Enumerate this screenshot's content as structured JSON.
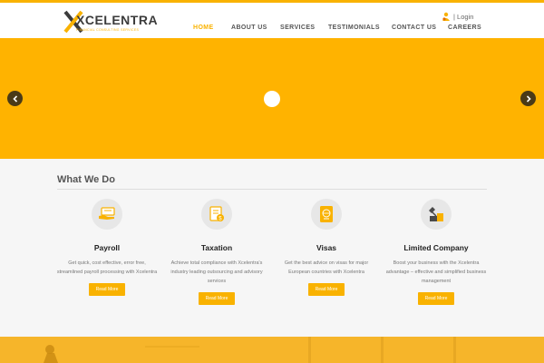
{
  "brand": {
    "name": "XCELENTRA",
    "tagline": "FINANCIAL CONSULTING SERVICES",
    "accent": "#f9b200"
  },
  "header": {
    "login_label": "| Login",
    "login_icon": "user-icon"
  },
  "nav": {
    "items": [
      {
        "label": "HOME",
        "active": true
      },
      {
        "label": "ABOUT US",
        "active": false
      },
      {
        "label": "SERVICES",
        "active": false
      },
      {
        "label": "TESTIMONIALS",
        "active": false
      },
      {
        "label": "CONTACT US",
        "active": false
      },
      {
        "label": "CAREERS",
        "active": false
      }
    ]
  },
  "slider": {
    "background": "#ffb300",
    "prev_icon": "chevron-left-icon",
    "next_icon": "chevron-right-icon"
  },
  "what_we_do": {
    "title": "What We Do",
    "cards": [
      {
        "icon": "payroll-icon",
        "title": "Payroll",
        "text": "Get quick, cost effective, error free, streamlined payroll processing with Xcelentra",
        "button": "Read More"
      },
      {
        "icon": "taxation-icon",
        "title": "Taxation",
        "text": "Achieve total compliance with Xcelentra's industry leading outsourcing and advisory services",
        "button": "Read More"
      },
      {
        "icon": "passport-icon",
        "title": "Visas",
        "text": "Get the best advice on visas for major European countries with Xcelentra",
        "button": "Read More"
      },
      {
        "icon": "company-icon",
        "title": "Limited Company",
        "text": "Boost your business with the Xcelentra advantage – effective and simplified business management",
        "button": "Read More"
      }
    ]
  }
}
